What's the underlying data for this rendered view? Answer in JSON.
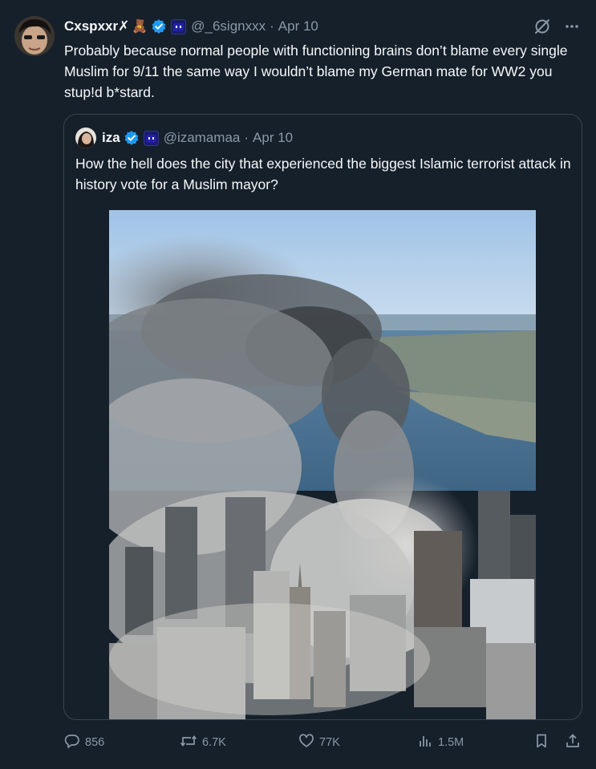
{
  "tweet": {
    "display_name": "Cxspxxr✗",
    "name_emoji": "🧸",
    "handle": "@_6signxxx",
    "separator": "·",
    "date": "Apr 10",
    "text": "Probably because normal people with functioning brains don’t blame every single Muslim for 9/11 the same way I wouldn’t blame my German mate for WW2 you stup!d b*stard."
  },
  "quote": {
    "display_name": "iza",
    "handle": "@izamamaa",
    "separator": "·",
    "date": "Apr 10",
    "text": "How the hell does the city that experienced the biggest Islamic terrorist attack in history vote for a Muslim mayor?"
  },
  "actions": {
    "replies": "856",
    "reposts": "6.7K",
    "likes": "77K",
    "views": "1.5M"
  },
  "icons": {
    "verified": "verified-badge-icon",
    "affiliate": "affiliate-badge-icon",
    "grok": "grok-icon",
    "more": "more-icon",
    "reply": "reply-icon",
    "repost": "repost-icon",
    "like": "like-icon",
    "views": "views-icon",
    "bookmark": "bookmark-icon",
    "share": "share-icon"
  },
  "colors": {
    "background": "#15202b",
    "text": "#f7f9f9",
    "secondary_text": "#8b98a5",
    "accent": "#1d9bf0",
    "border": "#38444d"
  }
}
